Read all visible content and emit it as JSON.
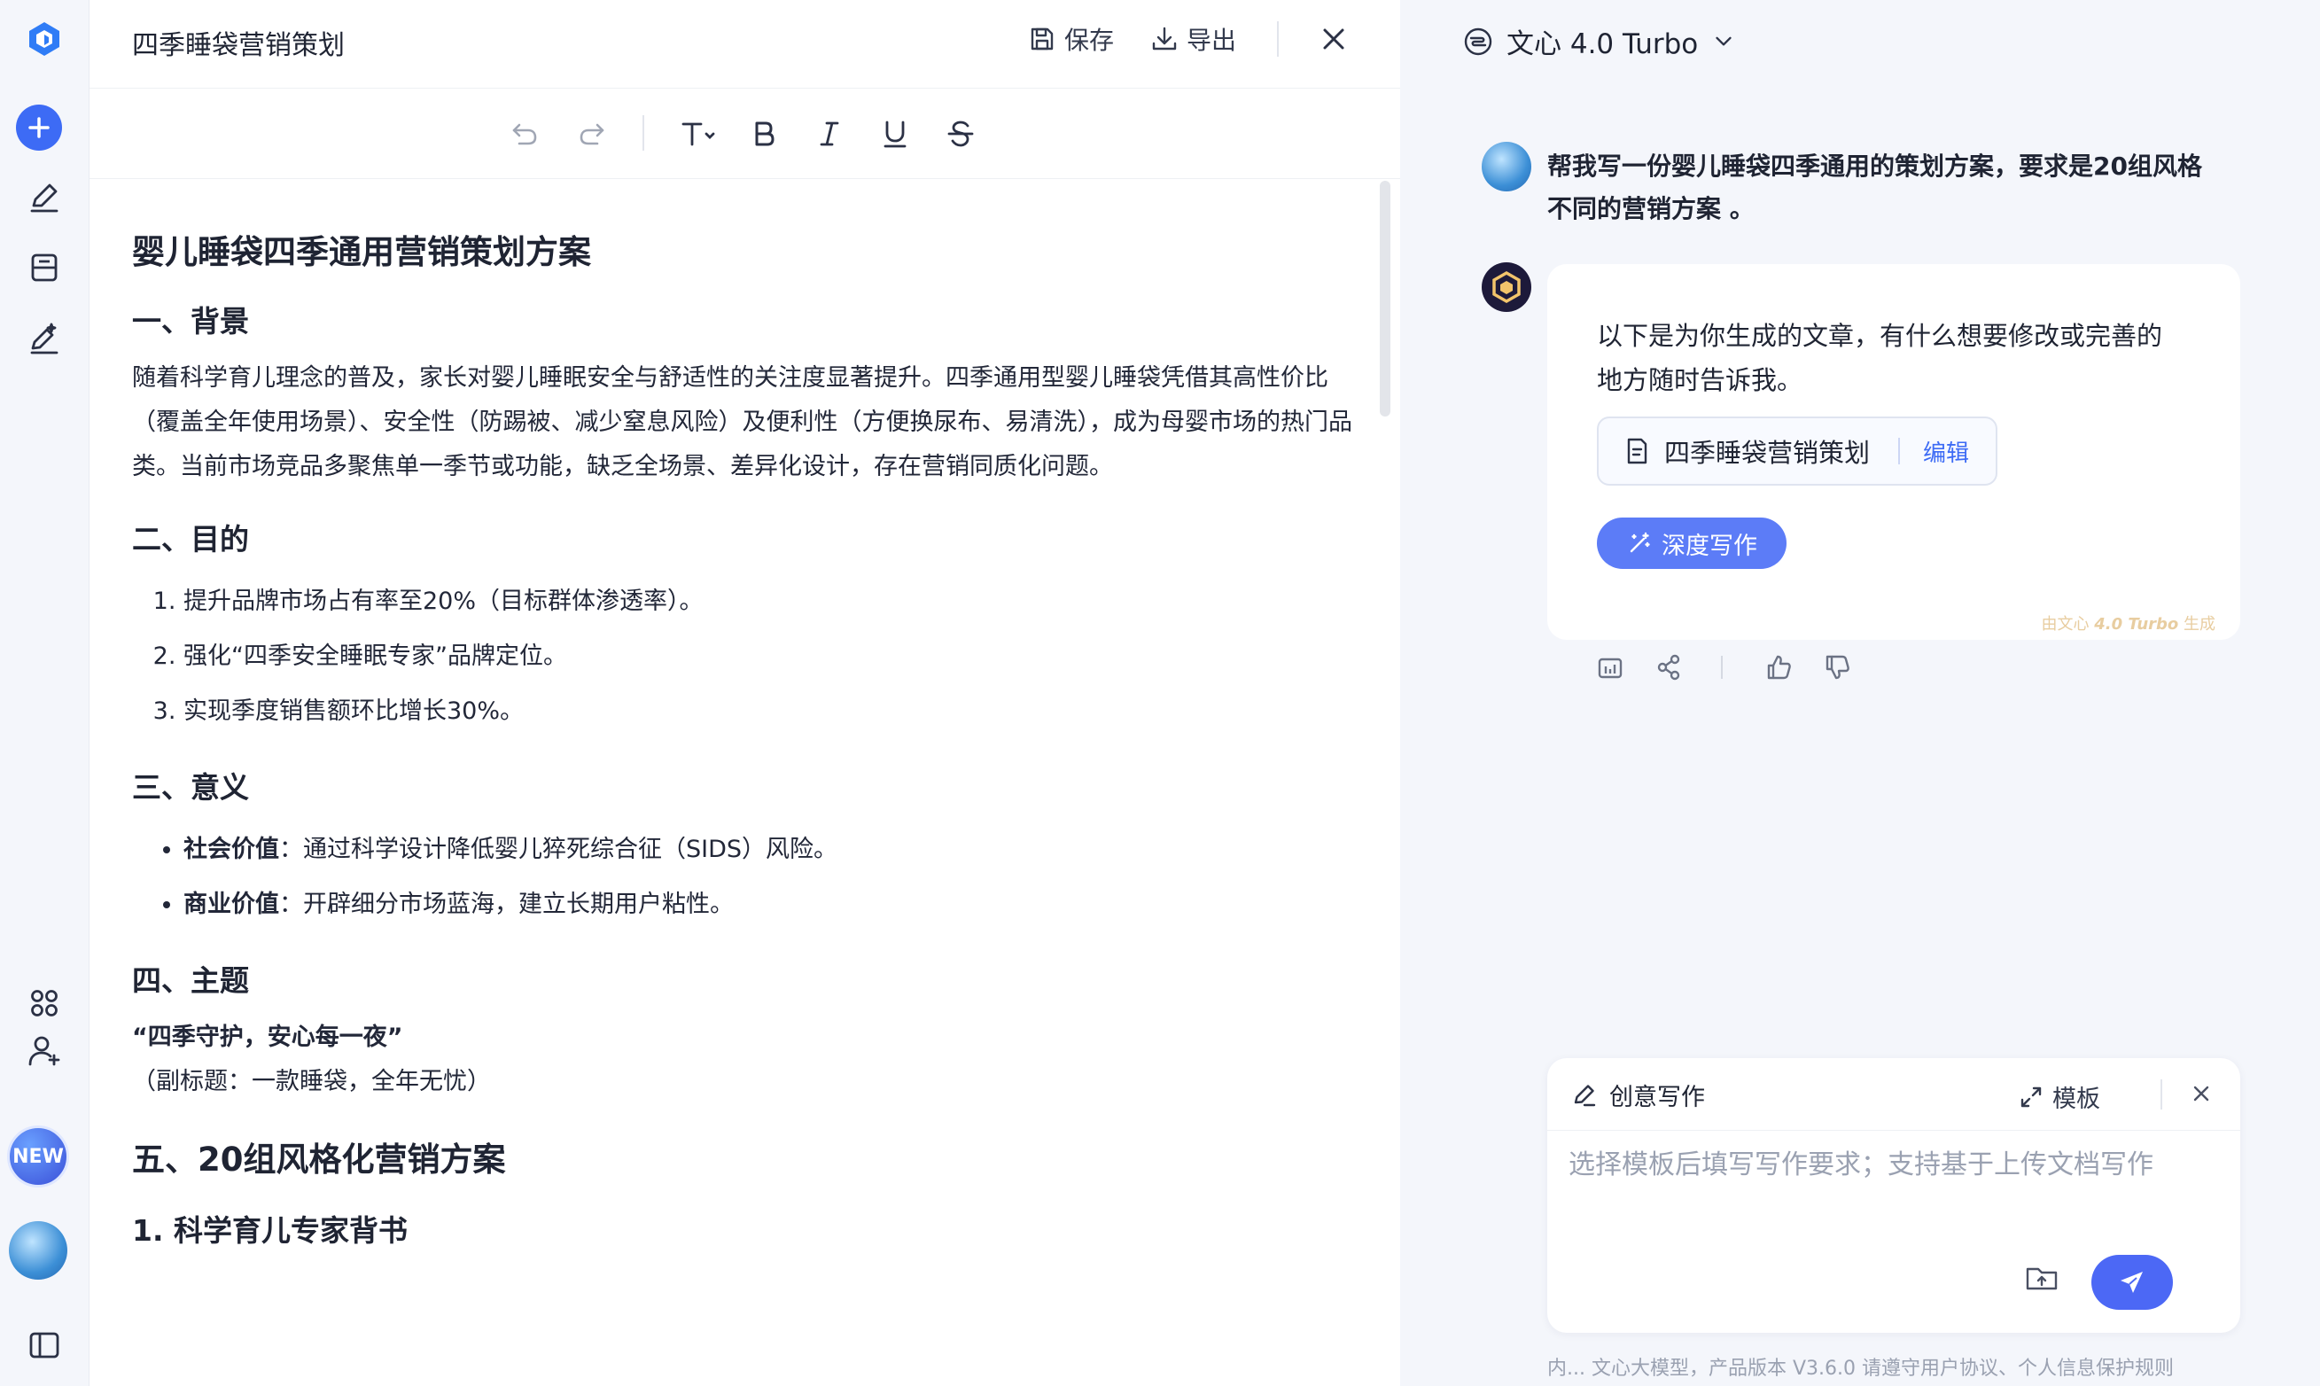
{
  "editor": {
    "title": "四季睡袋营销策划",
    "save_label": "保存",
    "export_label": "导出"
  },
  "document": {
    "title": "婴儿睡袋四季通用营销策划方案",
    "background": {
      "heading": "一、背景",
      "text": "随着科学育儿理念的普及，家长对婴儿睡眠安全与舒适性的关注度显著提升。四季通用型婴儿睡袋凭借其高性价比（覆盖全年使用场景）、安全性（防踢被、减少窒息风险）及便利性（方便换尿布、易清洗），成为母婴市场的热门品类。当前市场竞品多聚焦单一季节或功能，缺乏全场景、差异化设计，存在营销同质化问题。"
    },
    "goals": {
      "heading": "二、目的",
      "items": [
        "提升品牌市场占有率至20%（目标群体渗透率）。",
        "强化“四季安全睡眠专家”品牌定位。",
        "实现季度销售额环比增长30%。"
      ]
    },
    "meaning": {
      "heading": "三、意义",
      "items": [
        {
          "label": "社会价值",
          "text": "：通过科学设计降低婴儿猝死综合征（SIDS）风险。"
        },
        {
          "label": "商业价值",
          "text": "：开辟细分市场蓝海，建立长期用户粘性。"
        }
      ]
    },
    "theme": {
      "heading": "四、主题",
      "slogan": "“四季守护，安心每一夜”",
      "subtitle": "（副标题：一款睡袋，全年无忧）"
    },
    "plans": {
      "heading": "五、20组风格化营销方案",
      "first": "1. 科学育儿专家背书"
    }
  },
  "chat": {
    "model": "文心 4.0 Turbo",
    "user_message": "帮我写一份婴儿睡袋四季通用的策划方案，要求是20组风格不同的营销方案 。",
    "bot_message": "以下是为你生成的文章，有什么想要修改或完善的地方随时告诉我。",
    "doc_chip": "四季睡袋营销策划",
    "doc_chip_edit": "编辑",
    "deep_write": "深度写作",
    "generated_by_prefix": "由文心 ",
    "generated_by_model": "4.0 Turbo",
    "generated_by_suffix": " 生成"
  },
  "composer": {
    "mode": "创意写作",
    "template": "模板",
    "placeholder": "选择模板后填写写作要求；支持基于上传文档写作",
    "value": ""
  },
  "footer": "内... 文心大模型，产品版本 V3.6.0 请遵守用户协议、个人信息保护规则",
  "sidebar": {
    "new_badge": "NEW"
  },
  "colors": {
    "accent": "#3d6bf5",
    "deep_button": "#5c7cf7",
    "send_button": "#4c68f5"
  }
}
